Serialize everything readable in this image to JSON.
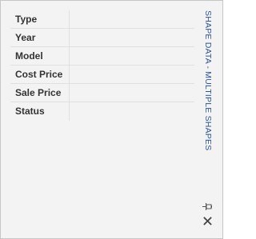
{
  "pane": {
    "title": "SHAPE DATA - MULTIPLE SHAPES",
    "fields": [
      {
        "label": "Type",
        "value": ""
      },
      {
        "label": "Year",
        "value": ""
      },
      {
        "label": "Model",
        "value": ""
      },
      {
        "label": "Cost Price",
        "value": ""
      },
      {
        "label": "Sale Price",
        "value": ""
      },
      {
        "label": "Status",
        "value": ""
      }
    ]
  },
  "icons": {
    "pin": "pin-icon",
    "close": "close-icon"
  },
  "colors": {
    "pane_background": "#f3f3f3",
    "title_text": "#2b5797",
    "label_text": "#333333"
  }
}
